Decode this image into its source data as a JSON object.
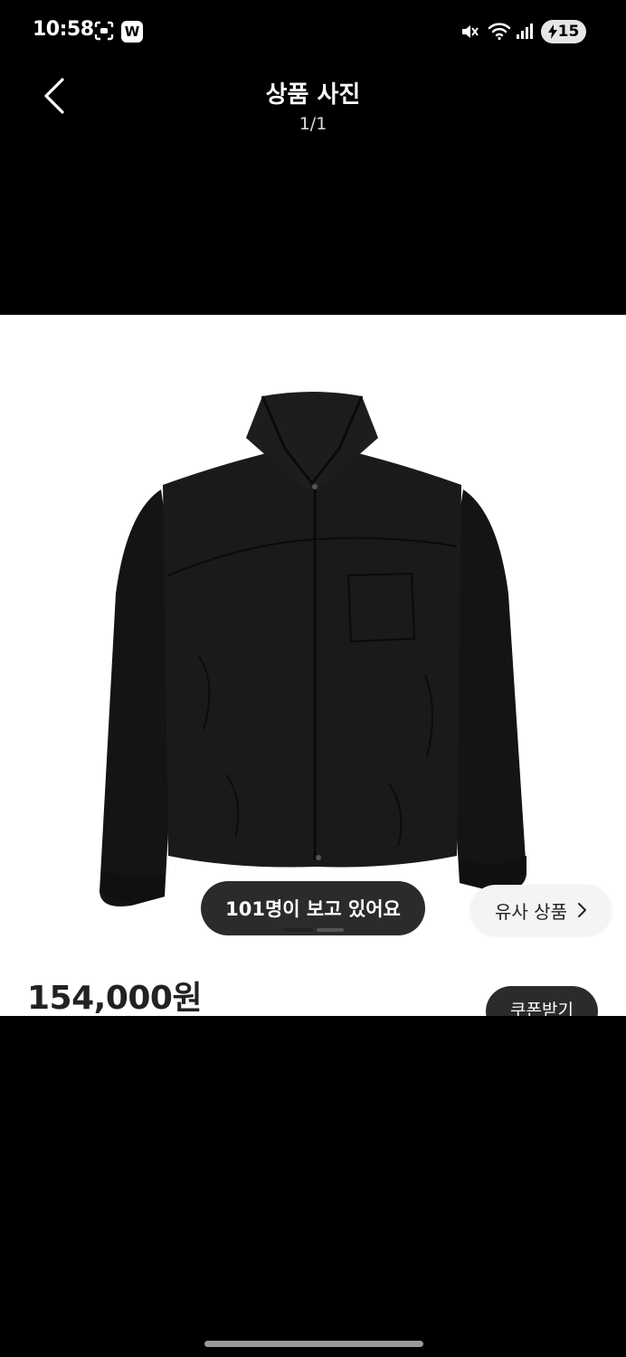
{
  "status_bar": {
    "time": "10:58",
    "app_badge": "W",
    "battery_level": "15",
    "icons": [
      "scan-icon",
      "mute-icon",
      "wifi-icon",
      "signal-icon",
      "battery-charging-icon"
    ]
  },
  "header": {
    "title": "상품 사진",
    "counter": "1/1",
    "back_icon": "chevron-left-icon"
  },
  "photo": {
    "subject": "black zip-up jacket",
    "viewers_text": "101명이 보고 있어요",
    "similar_label": "유사 상품",
    "similar_icon": "chevron-right-icon",
    "page_indicator": {
      "current": 1,
      "total": 2
    }
  },
  "product": {
    "price": "154,000원",
    "coupon_label": "쿠폰받기"
  },
  "colors": {
    "background": "#000000",
    "photo_background": "#ffffff",
    "pill_dark": "#2b2b2b",
    "pill_light": "#f4f4f4"
  }
}
